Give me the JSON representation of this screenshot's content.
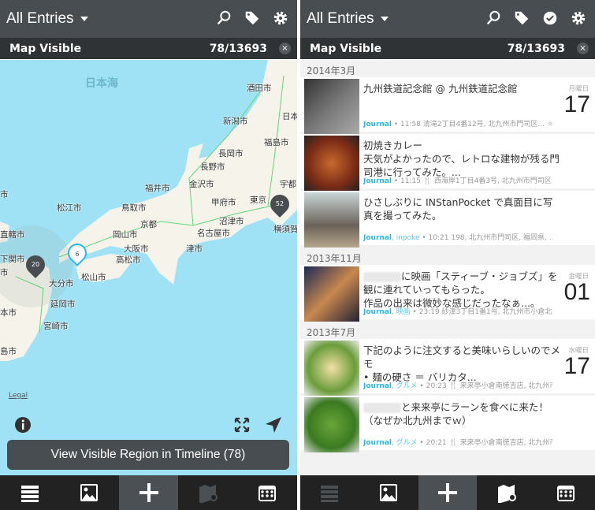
{
  "colors": {
    "header": "#474d51",
    "subbar": "#2f3336",
    "accent": "#29b6e8",
    "sea": "#9fe2f5",
    "land": "#f6f3ea",
    "tabbar": "#222222"
  },
  "left": {
    "header": {
      "title": "All Entries",
      "icons": [
        "search-icon",
        "tag-icon",
        "gear-icon"
      ]
    },
    "subbar": {
      "label": "Map Visible",
      "count": "78/13693",
      "close": "×"
    },
    "map": {
      "sea_label": "日本海",
      "labels": [
        "酒田市",
        "新潟市",
        "福島市",
        "日本",
        "長岡市",
        "長野市",
        "福井市",
        "金沢市",
        "宇都",
        "甲府市",
        "東京",
        "松江市",
        "鳥取市",
        "京都",
        "沼津市",
        "横須賀",
        "名古屋市",
        "岡山市",
        "大阪市",
        "津市",
        "高松市",
        "直轄市",
        "下関市",
        "市",
        "大分市",
        "松山市",
        "延岡市",
        "本市",
        "宮崎市",
        "島市",
        "市"
      ],
      "clusters": [
        {
          "count": "20",
          "style": "dark"
        },
        {
          "count": "6",
          "style": "selected"
        },
        {
          "count": "52",
          "style": "dark"
        }
      ],
      "legal": "Legal"
    },
    "view_button": "View Visible Region in Timeline (78)"
  },
  "right": {
    "header": {
      "title": "All Entries",
      "icons": [
        "search-icon",
        "tag-icon",
        "check-circle-icon",
        "gear-icon"
      ]
    },
    "subbar": {
      "label": "Map Visible",
      "count": "78/13693",
      "close": "×"
    },
    "sections": [
      {
        "date": "2014年3月",
        "entries": [
          {
            "text": "九州鉄道記念館 @ 九州鉄道記念館",
            "journal": "Journal",
            "tags": "",
            "meta": " • 11:58 清滝2丁目4番12号, 北九州市門司区... ☼ 1...",
            "weekday": "月曜日",
            "day": "17"
          },
          {
            "text": "初焼きカレー\n天気がよかったので、レトロな建物が残る門司港に行ってみた。...",
            "journal": "Journal",
            "tags": "",
            "meta": " • 11:15 🍴 西海岸1丁目4番3号, 北九州市門司区...",
            "weekday": "",
            "day": ""
          },
          {
            "text": "ひさしぶりに INStanPocket で真面目に写真を撮ってみた。",
            "journal": "Journal",
            "tags": ", inpoke",
            "meta": " • 10:21 198, 北九州市門司区, 福岡県, ...",
            "weekday": "",
            "day": ""
          }
        ]
      },
      {
        "date": "2013年11月",
        "entries": [
          {
            "text": "に映画「スティーブ・ジョブズ」を観に連れていってもらった。\n作品の出来は微妙な感じだったなぁ...。",
            "journal": "Journal",
            "tags": ", 映画",
            "meta": " • 23:19 砂津3丁目1番1号, 北九州市小倉北区...",
            "weekday": "金曜日",
            "day": "01",
            "blurred": true
          }
        ]
      },
      {
        "date": "2013年7月",
        "entries": [
          {
            "text": "下記のように注文すると美味いらしいのでメモ\n• 麺の硬さ ＝ バリカタ...",
            "journal": "Journal",
            "tags": ", グルメ",
            "meta": " • 20:23 🍴 来来亭小倉南徳吉店, 北九州市小...",
            "weekday": "水曜日",
            "day": "17"
          },
          {
            "text": "と来来亭にラーンを食べに来た！\n（なぜか北九州までｗ）",
            "journal": "Journal",
            "tags": ", グルメ",
            "meta": " • 20:21 🍴 来来亭小倉南徳吉店, 北九州市小...",
            "weekday": "",
            "day": "",
            "blurred": true
          }
        ]
      }
    ]
  },
  "tabbar": [
    "list-icon",
    "photos-icon",
    "add-icon",
    "map-icon",
    "calendar-icon"
  ]
}
